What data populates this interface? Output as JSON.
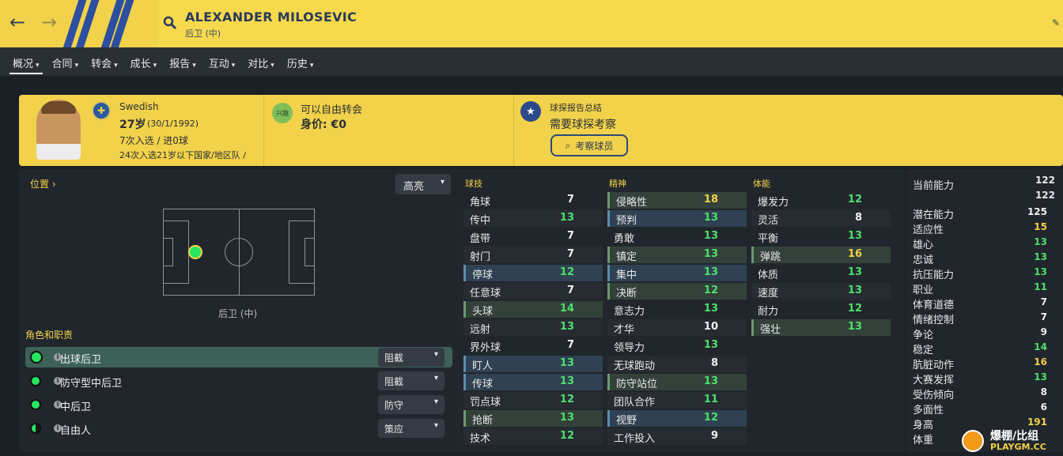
{
  "header": {
    "player_name": "ALEXANDER MILOSEVIC",
    "player_position": "后卫 (中)",
    "back_icon": "back-arrow-icon",
    "forward_icon": "forward-arrow-icon",
    "search_icon": "search-icon",
    "edit_icon": "pencil-icon"
  },
  "menu": {
    "items": [
      {
        "label": "概况"
      },
      {
        "label": "合同"
      },
      {
        "label": "转会"
      },
      {
        "label": "成长"
      },
      {
        "label": "报告"
      },
      {
        "label": "互动"
      },
      {
        "label": "对比"
      },
      {
        "label": "历史"
      }
    ]
  },
  "profile": {
    "nationality": "Swedish",
    "age": "27岁",
    "dob": "(30/1/1992)",
    "caps": "7次入选 / 进0球",
    "youth_caps": "24次入选21岁以下国家/地区队 /",
    "transfer_badge": "兴趣",
    "transfer_status": "可以自由转会",
    "value": "身价: €0",
    "scout_title": "球探报告总结",
    "scout_text": "需要球探考察",
    "scout_button": "考察球员"
  },
  "position_panel": {
    "position_link": "位置",
    "highlight_dropdown": "高亮",
    "position_label": "后卫 (中)",
    "roles_title": "角色和职责",
    "roles": [
      {
        "name": "出球后卫",
        "duty": "阻截"
      },
      {
        "name": "防守型中后卫",
        "duty": "阻截"
      },
      {
        "name": "中后卫",
        "duty": "防守"
      },
      {
        "name": "自由人",
        "duty": "策应"
      }
    ]
  },
  "attributes": {
    "technical_title": "球技",
    "mental_title": "精神",
    "physical_title": "体能",
    "technical": [
      {
        "name": "角球",
        "value": "7"
      },
      {
        "name": "传中",
        "value": "13"
      },
      {
        "name": "盘带",
        "value": "7"
      },
      {
        "name": "射门",
        "value": "7"
      },
      {
        "name": "停球",
        "value": "12"
      },
      {
        "name": "任意球",
        "value": "7"
      },
      {
        "name": "头球",
        "value": "14"
      },
      {
        "name": "远射",
        "value": "13"
      },
      {
        "name": "界外球",
        "value": "7"
      },
      {
        "name": "盯人",
        "value": "13"
      },
      {
        "name": "传球",
        "value": "13"
      },
      {
        "name": "罚点球",
        "value": "12"
      },
      {
        "name": "抢断",
        "value": "13"
      },
      {
        "name": "技术",
        "value": "12"
      }
    ],
    "mental": [
      {
        "name": "侵略性",
        "value": "18"
      },
      {
        "name": "预判",
        "value": "13"
      },
      {
        "name": "勇敢",
        "value": "13"
      },
      {
        "name": "镇定",
        "value": "13"
      },
      {
        "name": "集中",
        "value": "13"
      },
      {
        "name": "决断",
        "value": "12"
      },
      {
        "name": "意志力",
        "value": "13"
      },
      {
        "name": "才华",
        "value": "10"
      },
      {
        "name": "领导力",
        "value": "13"
      },
      {
        "name": "无球跑动",
        "value": "8"
      },
      {
        "name": "防守站位",
        "value": "13"
      },
      {
        "name": "团队合作",
        "value": "11"
      },
      {
        "name": "视野",
        "value": "12"
      },
      {
        "name": "工作投入",
        "value": "9"
      }
    ],
    "physical": [
      {
        "name": "爆发力",
        "value": "12"
      },
      {
        "name": "灵活",
        "value": "8"
      },
      {
        "name": "平衡",
        "value": "13"
      },
      {
        "name": "弹跳",
        "value": "16"
      },
      {
        "name": "体质",
        "value": "13"
      },
      {
        "name": "速度",
        "value": "13"
      },
      {
        "name": "耐力",
        "value": "12"
      },
      {
        "name": "强壮",
        "value": "13"
      }
    ]
  },
  "hidden": {
    "current_ability_label": "当前能力",
    "current_ability": "122",
    "current_ability_2": "122",
    "items": [
      {
        "name": "潜在能力",
        "value": "125"
      },
      {
        "name": "适应性",
        "value": "15"
      },
      {
        "name": "雄心",
        "value": "13"
      },
      {
        "name": "忠诚",
        "value": "13"
      },
      {
        "name": "抗压能力",
        "value": "13"
      },
      {
        "name": "职业",
        "value": "11"
      },
      {
        "name": "体育道德",
        "value": "7"
      },
      {
        "name": "情绪控制",
        "value": "7"
      },
      {
        "name": "争论",
        "value": "9"
      },
      {
        "name": "稳定",
        "value": "14"
      },
      {
        "name": "肮脏动作",
        "value": "16"
      },
      {
        "name": "大赛发挥",
        "value": "13"
      },
      {
        "name": "受伤倾向",
        "value": "8"
      },
      {
        "name": "多面性",
        "value": "6"
      },
      {
        "name": "身高",
        "value": "191"
      },
      {
        "name": "体重",
        "value": ""
      }
    ]
  },
  "watermark": {
    "top": "爆棚/比组",
    "bottom": "PLAYGM.CC"
  },
  "colors": {
    "accent_yellow": "#f2d24a",
    "green_value": "#4de06a",
    "yellow_value": "#f2d24a"
  }
}
